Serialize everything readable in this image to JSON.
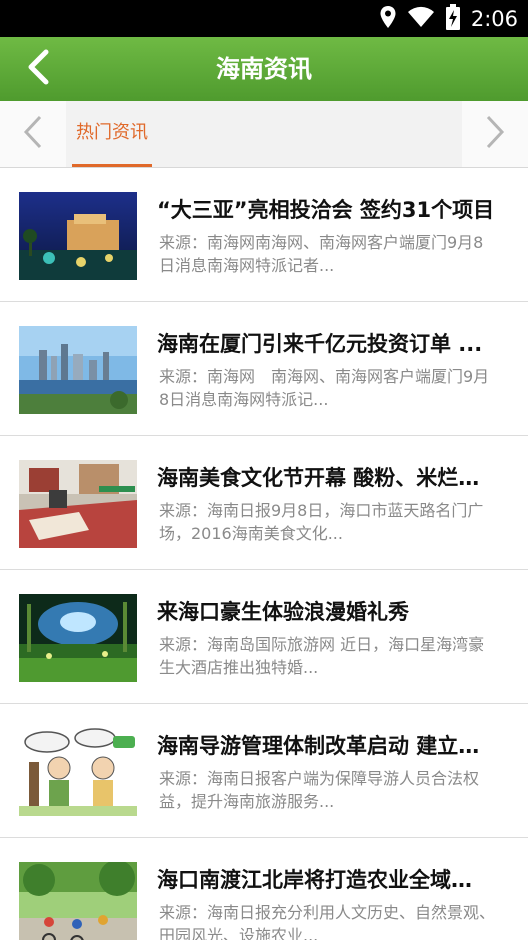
{
  "status_bar": {
    "time": "2:06",
    "icons": [
      "location-icon",
      "wifi-icon",
      "battery-charging-icon"
    ]
  },
  "app_bar": {
    "title": "海南资讯",
    "back_icon": "chevron-left-icon"
  },
  "tabs": {
    "left_arrow": "chevron-left-icon",
    "right_arrow": "chevron-right-icon",
    "active": "热门资讯",
    "accent": "#e0692a"
  },
  "colors": {
    "app_bar": "#5aa838",
    "divider": "#dcdcdc"
  },
  "news": [
    {
      "title": "“大三亚”亮相投洽会 签约31个项目",
      "desc": "来源：南海网南海网、南海网客户端厦门9月8日消息南海网特派记者..."
    },
    {
      "title": "海南在厦门引来千亿元投资订单 ...",
      "desc": "来源：南海网　南海网、南海网客户端厦门9月8日消息南海网特派记..."
    },
    {
      "title": "海南美食文化节开幕 酸粉、米烂…",
      "desc": "来源：海南日报9月8日，海口市蓝天路名门广场，2016海南美食文化..."
    },
    {
      "title": "来海口豪生体验浪漫婚礼秀",
      "desc": "来源：海南岛国际旅游网 近日，海口星海湾豪生大酒店推出独特婚..."
    },
    {
      "title": "海南导游管理体制改革启动 建立…",
      "desc": "来源：海南日报客户端为保障导游人员合法权益，提升海南旅游服务..."
    },
    {
      "title": "海口南渡江北岸将打造农业全域…",
      "desc": "来源：海南日报充分利用人文历史、自然景观、田园风光、设施农业..."
    }
  ]
}
